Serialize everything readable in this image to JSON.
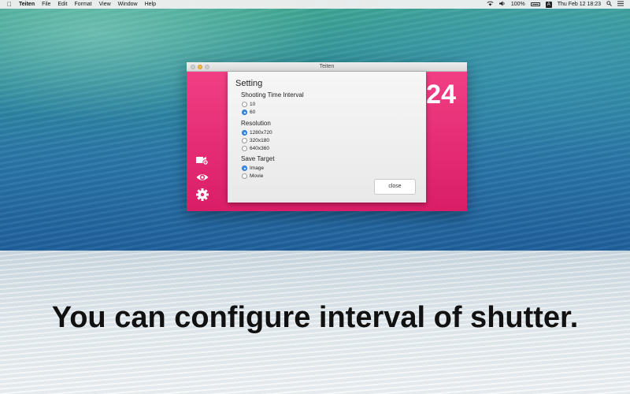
{
  "menubar": {
    "app_name": "Teiten",
    "items": [
      "File",
      "Edit",
      "Format",
      "View",
      "Window",
      "Help"
    ],
    "battery_percent": "100%",
    "input_source": "A",
    "clock": "Thu Feb 12  18:23"
  },
  "window": {
    "title": "Teiten",
    "counter": "24"
  },
  "settings": {
    "title": "Setting",
    "interval_label": "Shooting Time Interval",
    "interval_options": [
      "10",
      "60"
    ],
    "interval_selected": "60",
    "resolution_label": "Resolution",
    "resolution_options": [
      "1280x720",
      "320x180",
      "640x360"
    ],
    "resolution_selected": "1280x720",
    "save_label": "Save Target",
    "save_options": [
      "Image",
      "Movie"
    ],
    "save_selected": "Image",
    "close_label": "close"
  },
  "caption": "You can configure interval of shutter.",
  "colors": {
    "app_pink": "#e32a72",
    "radio_selected": "#3d8ee8"
  },
  "icons": [
    "apple-icon",
    "wifi-icon",
    "speaker-icon",
    "battery-icon",
    "search-icon",
    "list-icon",
    "camera-icon",
    "eye-icon",
    "gear-icon"
  ]
}
